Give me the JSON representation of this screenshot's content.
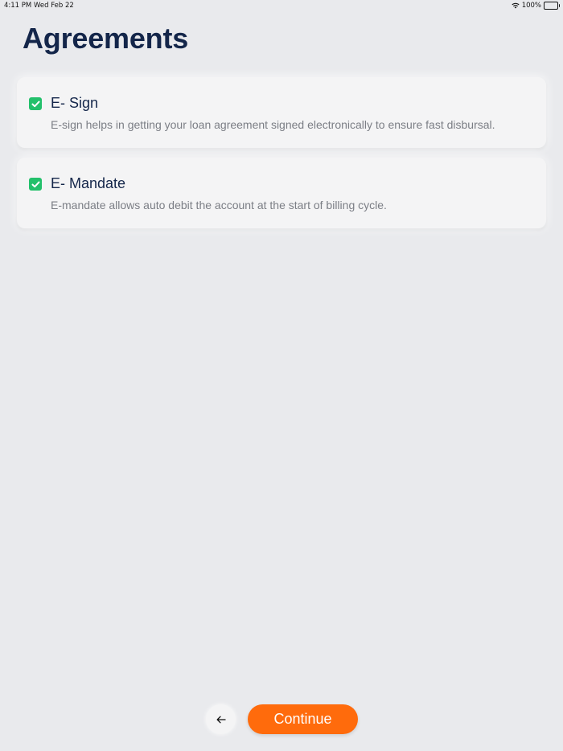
{
  "status_bar": {
    "time": "4:11 PM",
    "date": "Wed Feb 22",
    "battery": "100%",
    "wifi_icon": "wifi-icon",
    "battery_icon": "battery-icon"
  },
  "page": {
    "title": "Agreements"
  },
  "agreements": [
    {
      "title": "E- Sign",
      "description": "E-sign helps in getting your loan agreement signed electronically to ensure fast disbursal.",
      "checked": true
    },
    {
      "title": "E- Mandate",
      "description": "E-mandate allows auto debit the account at the start of billing cycle.",
      "checked": true
    }
  ],
  "footer": {
    "back_icon": "arrow-left-icon",
    "continue_label": "Continue"
  },
  "colors": {
    "background": "#e9eaed",
    "card": "#f4f4f5",
    "title_text": "#14264a",
    "description_text": "#7b7e85",
    "checkbox": "#23c06b",
    "primary_button": "#ff6b0c"
  }
}
